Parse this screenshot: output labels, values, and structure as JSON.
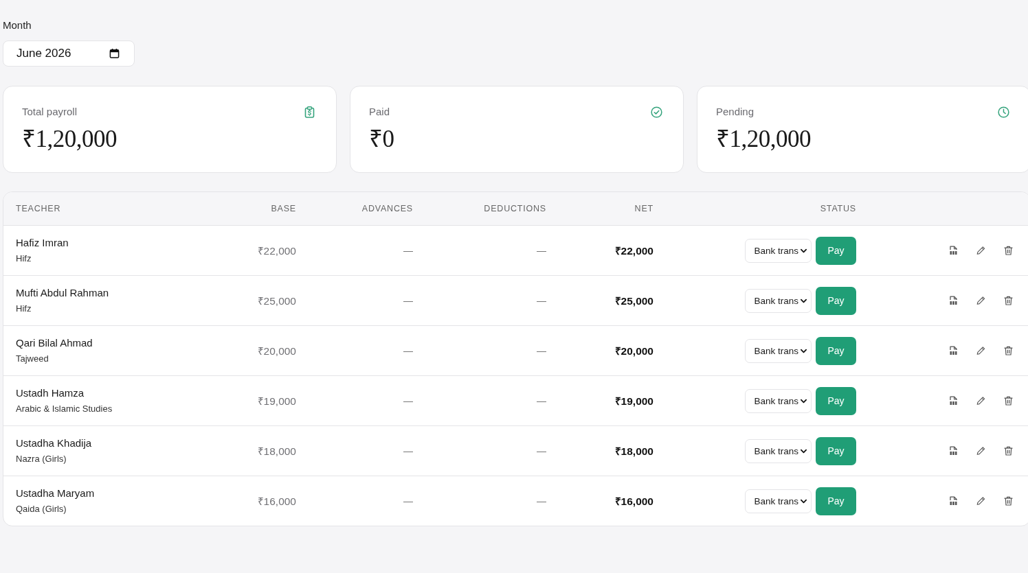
{
  "month": {
    "label": "Month",
    "value": "June 2026"
  },
  "stats": [
    {
      "kind": "total",
      "label": "Total payroll",
      "value": "₹1,20,000"
    },
    {
      "kind": "paid",
      "label": "Paid",
      "value": "₹0"
    },
    {
      "kind": "pending",
      "label": "Pending",
      "value": "₹1,20,000"
    }
  ],
  "table": {
    "columns": [
      "TEACHER",
      "BASE",
      "ADVANCES",
      "DEDUCTIONS",
      "NET",
      "STATUS"
    ],
    "rows": [
      {
        "name": "Hafiz Imran",
        "subject": "Hifz",
        "base": "₹22,000",
        "advances": "—",
        "deductions": "—",
        "net": "₹22,000",
        "method": "Bank trans",
        "action": "Pay"
      },
      {
        "name": "Mufti Abdul Rahman",
        "subject": "Hifz",
        "base": "₹25,000",
        "advances": "—",
        "deductions": "—",
        "net": "₹25,000",
        "method": "Bank trans",
        "action": "Pay"
      },
      {
        "name": "Qari Bilal Ahmad",
        "subject": "Tajweed",
        "base": "₹20,000",
        "advances": "—",
        "deductions": "—",
        "net": "₹20,000",
        "method": "Bank trans",
        "action": "Pay"
      },
      {
        "name": "Ustadh Hamza",
        "subject": "Arabic & Islamic Studies",
        "base": "₹19,000",
        "advances": "—",
        "deductions": "—",
        "net": "₹19,000",
        "method": "Bank trans",
        "action": "Pay"
      },
      {
        "name": "Ustadha Khadija",
        "subject": "Nazra (Girls)",
        "base": "₹18,000",
        "advances": "—",
        "deductions": "—",
        "net": "₹18,000",
        "method": "Bank trans",
        "action": "Pay"
      },
      {
        "name": "Ustadha Maryam",
        "subject": "Qaida (Girls)",
        "base": "₹16,000",
        "advances": "—",
        "deductions": "—",
        "net": "₹16,000",
        "method": "Bank trans",
        "action": "Pay"
      }
    ]
  }
}
